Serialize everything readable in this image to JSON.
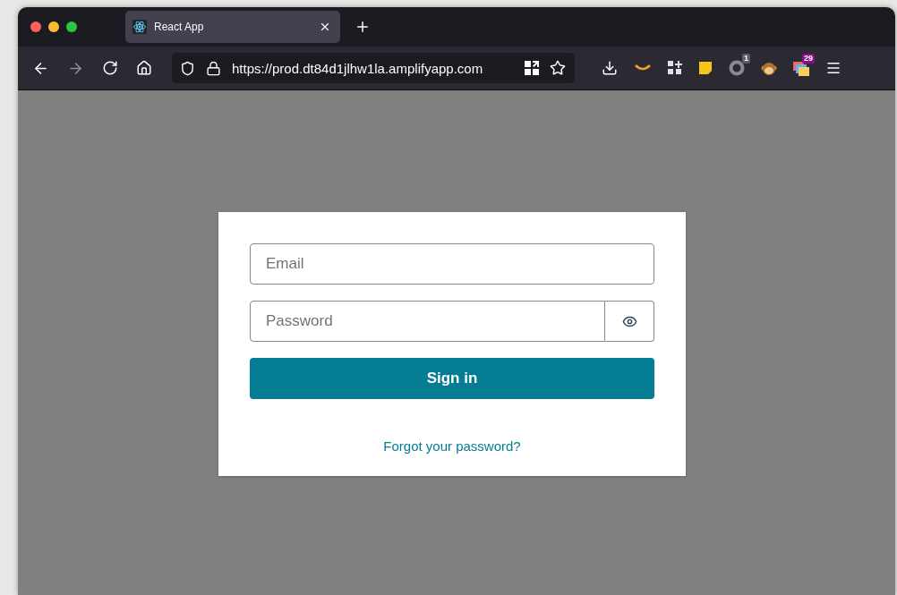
{
  "browser": {
    "tab": {
      "title": "React App"
    },
    "url": "https://prod.dt84d1jlhw1la.amplifyapp.com",
    "extensions": [
      {
        "kind": "download"
      },
      {
        "kind": "smile"
      },
      {
        "kind": "grid"
      },
      {
        "kind": "note"
      },
      {
        "kind": "ring",
        "badge": "1"
      },
      {
        "kind": "monkey"
      },
      {
        "kind": "stack",
        "badge": "29"
      }
    ]
  },
  "sign_in": {
    "email": {
      "placeholder": "Email"
    },
    "password": {
      "placeholder": "Password"
    },
    "submit": "Sign in",
    "forgot_link": "Forgot your password?"
  }
}
